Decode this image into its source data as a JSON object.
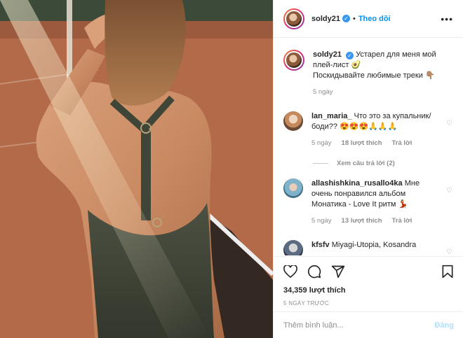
{
  "post": {
    "username": "soldy21",
    "follow_label": "Theo dõi",
    "more_label": "•••"
  },
  "caption": {
    "username": "soldy21",
    "text_line1": "Устарел для меня мой плей-лист",
    "text_line2": "Поскидывайте любимые треки",
    "time": "5 ngày"
  },
  "comments": [
    {
      "username": "lan_maria_",
      "text": "Что это за купальник/ боди??",
      "emoji": "😍😍😍🙏🙏🙏",
      "time": "5 ngày",
      "likes": "18 lượt thích",
      "reply": "Trả lời",
      "view_replies": "Xem câu trả lời (2)"
    },
    {
      "username": "allashishkina_rusallo4ka",
      "text": "Мне очень понравился альбом Монатика - Love It ритм",
      "emoji": "💃",
      "time": "5 ngày",
      "likes": "13 lượt thích",
      "reply": "Trả lời"
    },
    {
      "username": "kfsfv",
      "text": "Miyagi-Utopia, Kosandra"
    }
  ],
  "actions": {
    "icons": [
      "heart-icon",
      "comment-icon",
      "share-icon",
      "bookmark-icon"
    ],
    "likes": "34,359 lượt thích",
    "time": "5 NGÀY TRƯỚC"
  },
  "add_comment": {
    "placeholder": "Thêm bình luận...",
    "post_label": "Đăng"
  },
  "colors": {
    "link": "#0095f6",
    "verified": "#3897f0",
    "muted": "#8e8e8e",
    "post_disabled": "#b2dffc"
  }
}
